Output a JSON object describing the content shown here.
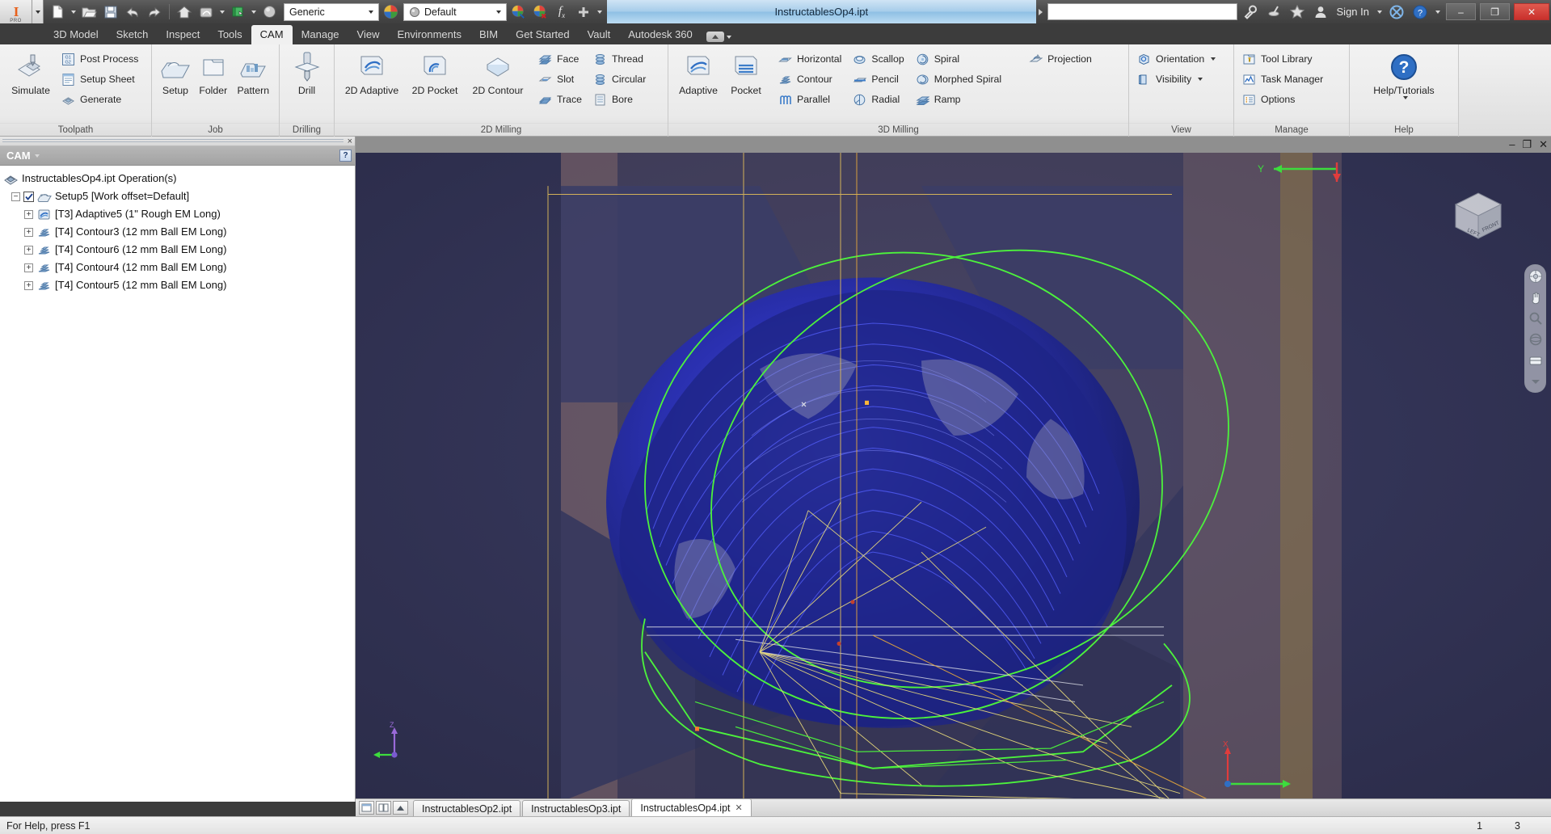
{
  "window": {
    "document_title": "InstructablesOp4.ipt",
    "minimize_label": "–",
    "maximize_label": "❐",
    "close_label": "✕",
    "sign_in_label": "Sign In",
    "search_placeholder": ""
  },
  "quick_access": {
    "material_combo": "Generic",
    "appearance_combo": "Default",
    "items": [
      {
        "name": "new-icon",
        "label": "New"
      },
      {
        "name": "open-icon",
        "label": "Open"
      },
      {
        "name": "save-icon",
        "label": "Save"
      },
      {
        "name": "undo-icon",
        "label": "Undo"
      },
      {
        "name": "redo-icon",
        "label": "Redo"
      },
      {
        "name": "home-icon",
        "label": "Home"
      },
      {
        "name": "appearance-icon",
        "label": "Appearance"
      },
      {
        "name": "material-icon",
        "label": "Material"
      },
      {
        "name": "select-icon",
        "label": "Select"
      }
    ]
  },
  "ribbon_tabs": [
    {
      "label": "3D Model",
      "active": false
    },
    {
      "label": "Sketch",
      "active": false
    },
    {
      "label": "Inspect",
      "active": false
    },
    {
      "label": "Tools",
      "active": false
    },
    {
      "label": "CAM",
      "active": true
    },
    {
      "label": "Manage",
      "active": false
    },
    {
      "label": "View",
      "active": false
    },
    {
      "label": "Environments",
      "active": false
    },
    {
      "label": "BIM",
      "active": false
    },
    {
      "label": "Get Started",
      "active": false
    },
    {
      "label": "Vault",
      "active": false
    },
    {
      "label": "Autodesk 360",
      "active": false
    }
  ],
  "ribbon_panels": [
    {
      "title": "Toolpath",
      "big": [
        {
          "label": "Simulate",
          "icon": "simulate-icon"
        }
      ],
      "small": [
        {
          "label": "Post Process",
          "icon": "post-process-icon"
        },
        {
          "label": "Setup Sheet",
          "icon": "setup-sheet-icon"
        },
        {
          "label": "Generate",
          "icon": "generate-icon"
        }
      ]
    },
    {
      "title": "Job",
      "big": [
        {
          "label": "Setup",
          "icon": "setup-icon"
        },
        {
          "label": "Folder",
          "icon": "folder-icon"
        },
        {
          "label": "Pattern",
          "icon": "pattern-icon"
        }
      ],
      "small": []
    },
    {
      "title": "Drilling",
      "big": [
        {
          "label": "Drill",
          "icon": "drill-icon"
        }
      ],
      "small": []
    },
    {
      "title": "2D Milling",
      "big": [
        {
          "label": "2D Adaptive",
          "icon": "2d-adaptive-icon"
        },
        {
          "label": "2D Pocket",
          "icon": "2d-pocket-icon"
        },
        {
          "label": "2D Contour",
          "icon": "2d-contour-icon"
        }
      ],
      "small": [
        {
          "label": "Face",
          "icon": "face-icon"
        },
        {
          "label": "Slot",
          "icon": "slot-icon"
        },
        {
          "label": "Trace",
          "icon": "trace-icon"
        },
        {
          "label": "Thread",
          "icon": "thread-icon"
        },
        {
          "label": "Circular",
          "icon": "circular-icon"
        },
        {
          "label": "Bore",
          "icon": "bore-icon"
        }
      ]
    },
    {
      "title": "3D Milling",
      "big": [
        {
          "label": "Adaptive",
          "icon": "adaptive-icon"
        },
        {
          "label": "Pocket",
          "icon": "pocket-icon"
        }
      ],
      "small": [
        {
          "label": "Horizontal",
          "icon": "horizontal-icon"
        },
        {
          "label": "Contour",
          "icon": "contour-icon"
        },
        {
          "label": "Parallel",
          "icon": "parallel-icon"
        },
        {
          "label": "Scallop",
          "icon": "scallop-icon"
        },
        {
          "label": "Pencil",
          "icon": "pencil-icon"
        },
        {
          "label": "Radial",
          "icon": "radial-icon"
        },
        {
          "label": "Spiral",
          "icon": "spiral-icon"
        },
        {
          "label": "Morphed Spiral",
          "icon": "morphed-spiral-icon"
        },
        {
          "label": "Ramp",
          "icon": "ramp-icon"
        },
        {
          "label": "Projection",
          "icon": "projection-icon"
        }
      ]
    },
    {
      "title": "View",
      "big": [],
      "small": [
        {
          "label": "Orientation",
          "icon": "orientation-icon",
          "dropdown": true
        },
        {
          "label": "Visibility",
          "icon": "visibility-icon",
          "dropdown": true
        }
      ]
    },
    {
      "title": "Manage",
      "big": [],
      "small": [
        {
          "label": "Tool Library",
          "icon": "tool-library-icon"
        },
        {
          "label": "Task Manager",
          "icon": "task-manager-icon"
        },
        {
          "label": "Options",
          "icon": "options-icon"
        }
      ]
    },
    {
      "title": "Help",
      "big": [
        {
          "label": "Help/Tutorials",
          "icon": "help-icon",
          "dropdown": true
        }
      ],
      "small": []
    }
  ],
  "browser": {
    "panel_title": "CAM",
    "help_badge": "?",
    "close_label": "×",
    "root": "InstructablesOp4.ipt Operation(s)",
    "setup": "Setup5 [Work offset=Default]",
    "operations": [
      {
        "label": "[T3] Adaptive5 (1\" Rough EM Long)",
        "icon": "adaptive-op-icon"
      },
      {
        "label": "[T4] Contour3 (12 mm Ball EM Long)",
        "icon": "contour-op-icon"
      },
      {
        "label": "[T4] Contour6 (12 mm Ball EM Long)",
        "icon": "contour-op-icon"
      },
      {
        "label": "[T4] Contour4 (12 mm Ball EM Long)",
        "icon": "contour-op-icon"
      },
      {
        "label": "[T4] Contour5 (12 mm Ball EM Long)",
        "icon": "contour-op-icon"
      }
    ]
  },
  "viewport": {
    "minimize_label": "–",
    "restore_label": "❐",
    "close_label": "✕",
    "axis_y_label": "Y",
    "axis_z_label": "Z",
    "axis_x_label": "X",
    "navcube_faces": [
      "FRONT",
      "LEFT"
    ],
    "colors": {
      "background": "#2f3050",
      "toolpath_blue": "#2b35f0",
      "stock_green": "#4cf23c",
      "rapid_yellow": "#e8d36a",
      "model_gray": "#7d7f94"
    }
  },
  "doc_tabs": [
    {
      "label": "InstructablesOp2.ipt",
      "active": false,
      "closable": false
    },
    {
      "label": "InstructablesOp3.ipt",
      "active": false,
      "closable": false
    },
    {
      "label": "InstructablesOp4.ipt",
      "active": true,
      "closable": true
    }
  ],
  "status_bar": {
    "message": "For Help, press F1",
    "value_1": "1",
    "value_2": "3"
  }
}
